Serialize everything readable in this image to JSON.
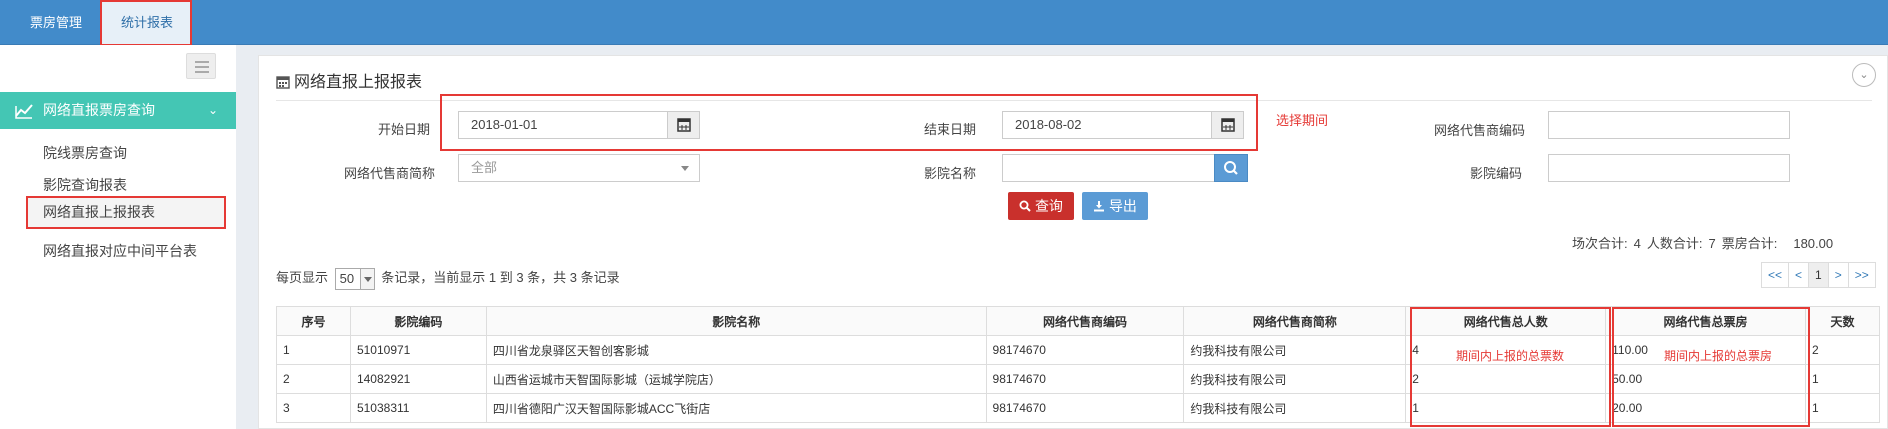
{
  "topnav": {
    "tabs": [
      {
        "label": "票房管理"
      },
      {
        "label": "统计报表"
      }
    ]
  },
  "sidebar": {
    "menu_label": "网络直报票房查询",
    "items": [
      {
        "label": "院线票房查询"
      },
      {
        "label": "影院查询报表"
      },
      {
        "label": "网络直报上报报表"
      },
      {
        "label": "网络直报对应中间平台表"
      }
    ]
  },
  "panel": {
    "title": "网络直报上报报表"
  },
  "form": {
    "start_date_label": "开始日期",
    "start_date_value": "2018-01-01",
    "end_date_label": "结束日期",
    "end_date_value": "2018-08-02",
    "period_note": "选择期间",
    "agent_code_label": "网络代售商编码",
    "agent_code_value": "",
    "agent_name_label": "网络代售商简称",
    "agent_name_value": "全部",
    "cinema_name_label": "影院名称",
    "cinema_name_value": "",
    "cinema_code_label": "影院编码",
    "cinema_code_value": ""
  },
  "buttons": {
    "query": "查询",
    "export": "导出"
  },
  "totals": {
    "sessions_label": "场次合计:",
    "sessions_value": "4",
    "people_label": "人数合计:",
    "people_value": "7",
    "box_label": "票房合计:",
    "box_value": "180.00"
  },
  "paging": {
    "prefix": "每页显示",
    "page_size": "50",
    "info": "条记录，当前显示 1 到 3 条，共 3 条记录",
    "first": "<<",
    "prev": "<",
    "current": "1",
    "next": ">",
    "last": ">>"
  },
  "table": {
    "headers": [
      "序号",
      "影院编码",
      "影院名称",
      "网络代售商编码",
      "网络代售商简称",
      "网络代售总人数",
      "网络代售总票房",
      "天数"
    ],
    "rows": [
      [
        "1",
        "51010971",
        "四川省龙泉驿区天智创客影城",
        "98174670",
        "约我科技有限公司",
        "4",
        "110.00",
        "2"
      ],
      [
        "2",
        "14082921",
        "山西省运城市天智国际影城（运城学院店）",
        "98174670",
        "约我科技有限公司",
        "2",
        "50.00",
        "1"
      ],
      [
        "3",
        "51038311",
        "四川省德阳广汉天智国际影城ACC飞街店",
        "98174670",
        "约我科技有限公司",
        "1",
        "20.00",
        "1"
      ]
    ],
    "people_note": "期间内上报的总票数",
    "box_note": "期间内上报的总票房"
  },
  "colors": {
    "topbar": "#428bca",
    "menu_active": "#44c6b4",
    "highlight": "#e53935",
    "query_btn": "#c9302c",
    "export_btn": "#5b9bd5"
  }
}
